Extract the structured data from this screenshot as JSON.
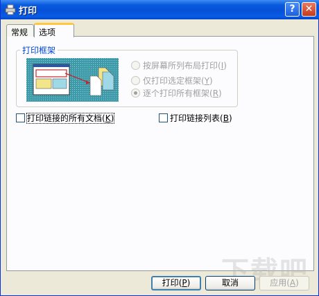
{
  "window": {
    "title": "打印",
    "icon": "printer-icon",
    "help_label": "?",
    "close_label": "✕"
  },
  "tabs": [
    {
      "label": "常规",
      "selected": false
    },
    {
      "label": "选项",
      "selected": true
    }
  ],
  "frames_group": {
    "legend": "打印框架",
    "options": [
      {
        "label": "按屏幕所列布局打印",
        "hotkey": "I",
        "checked": false,
        "enabled": false
      },
      {
        "label": "仅打印选定框架",
        "hotkey": "Y",
        "checked": false,
        "enabled": false
      },
      {
        "label": "逐个打印所有框架",
        "hotkey": "R",
        "checked": true,
        "enabled": false
      }
    ]
  },
  "checkboxes": [
    {
      "label": "打印链接的所有文档",
      "hotkey": "K",
      "checked": false
    },
    {
      "label": "打印链接列表",
      "hotkey": "B",
      "checked": false
    }
  ],
  "buttons": {
    "print": {
      "label": "打印",
      "hotkey": "P"
    },
    "cancel": {
      "label": "取消"
    },
    "apply": {
      "label": "应用",
      "hotkey": "A",
      "enabled": false
    }
  },
  "watermark": "下载吧",
  "colors": {
    "titlebar": "#0a5be0",
    "accent_legend": "#0046d5",
    "preview_bg": "#3e9aa8"
  }
}
